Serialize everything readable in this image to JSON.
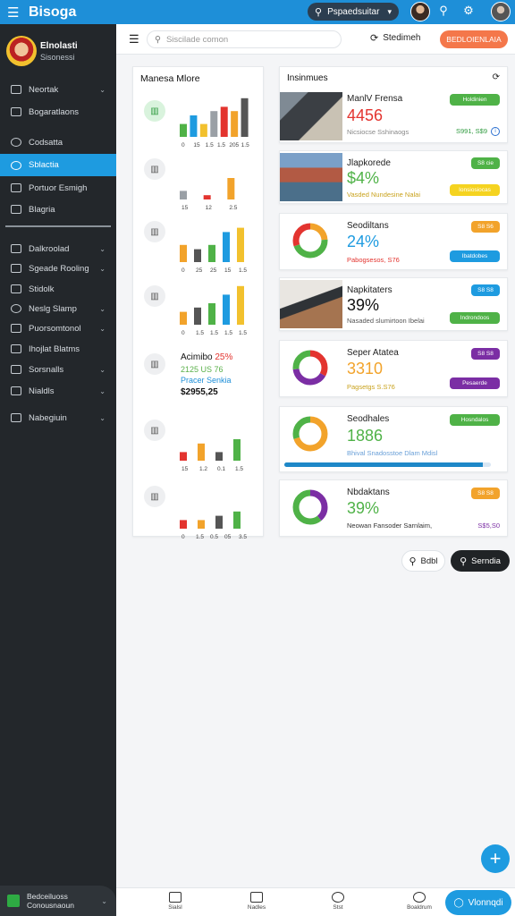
{
  "app": {
    "title": "Bisoga"
  },
  "topbar": {
    "search_label": "Pspaedsuitar",
    "icons": [
      "menu-icon",
      "search-icon",
      "avatar",
      "location-icon",
      "network-icon",
      "profile-avatar"
    ]
  },
  "sidebar": {
    "profile": {
      "name": "Elnolasti",
      "subtitle": "Sisonessi"
    },
    "items": [
      {
        "label": "Neortak",
        "chevron": true
      },
      {
        "label": "Bogaratlaons",
        "chevron": false
      },
      {
        "label": "Codsatta",
        "chevron": false
      },
      {
        "label": "Sblactia",
        "chevron": false,
        "active": true
      },
      {
        "label": "Portuor Esmigh",
        "chevron": false
      },
      {
        "label": "Blagria",
        "chevron": false
      },
      {
        "label": "Dalkroolad",
        "chevron": true
      },
      {
        "label": "Sgeade Rooling",
        "chevron": true
      },
      {
        "label": "Stidolk",
        "chevron": false
      },
      {
        "label": "Neslg Slamp",
        "chevron": true
      },
      {
        "label": "Puorsomtonol",
        "chevron": true
      },
      {
        "label": "Ihojlat Blatms",
        "chevron": false
      },
      {
        "label": "Sorsnalls",
        "chevron": true
      },
      {
        "label": "Nialdls",
        "chevron": true
      },
      {
        "label": "Nabegiuin",
        "chevron": true
      }
    ],
    "footer": {
      "line1": "Bedceiluoss",
      "line2": "Conousnaoun"
    }
  },
  "header": {
    "search_placeholder": "Siscilade comon",
    "button_label": "Stedimeh",
    "cta_label": "BEDLOIENLAIA"
  },
  "left_panel": {
    "title": "Manesa Mlore",
    "rows": [
      {
        "ticks": [
          "0",
          "15",
          "1.5",
          "1.5",
          "205",
          "1.5"
        ],
        "values": [
          3,
          5,
          3,
          6,
          7,
          6,
          9
        ]
      },
      {
        "ticks": [
          "15",
          "12",
          "2.5"
        ],
        "values": [
          2,
          1,
          5
        ]
      },
      {
        "ticks": [
          "0",
          "25",
          "25",
          "15",
          "1.5"
        ],
        "values": [
          4,
          3,
          4,
          7,
          8
        ]
      },
      {
        "ticks": [
          "0",
          "1.5",
          "1.5",
          "1.5",
          "1.5"
        ],
        "values": [
          3,
          4,
          5,
          7,
          9
        ]
      },
      {
        "ticks": [],
        "values": []
      },
      {
        "ticks": [
          "15",
          "1.2",
          "0.1",
          "1.5"
        ],
        "values": [
          2,
          4,
          2,
          5
        ]
      },
      {
        "ticks": [
          "0",
          "1.5",
          "0.5",
          "05",
          "3.5"
        ],
        "values": [
          2,
          2,
          3,
          4
        ]
      }
    ],
    "activity": {
      "title": "Acimibo",
      "highlight": "25%",
      "line2": "2125 US 76",
      "line3": "Pracer Senkia",
      "amount": "$2955,25"
    }
  },
  "insights": {
    "title": "Insinmues",
    "cards": [
      {
        "label": "ManlV Frensa",
        "value": "4456",
        "sub": "Nicsiocse Sshinaogs",
        "pill": "Holdinien",
        "small": "S991, S$9"
      },
      {
        "label": "Jlapkorede",
        "value": "$4%",
        "sub": "Vasded Nundesine Nalai",
        "pill": "S8 cie",
        "pill2": "Ionsiosiocas"
      },
      {
        "label": "Seodiltans",
        "value": "24%",
        "sub": "Pabogsesos, S76",
        "pill": "S8 S6",
        "pill2": "Ibatdobes"
      },
      {
        "label": "Napkitaters",
        "value": "39%",
        "sub": "Nasaded slumirtoon Ibelai",
        "pill": "S8 S8",
        "pill2": "Indrondoos"
      },
      {
        "label": "Seper Atatea",
        "value": "3310",
        "sub": "Pagsetgs S.S76",
        "pill": "S8 S8",
        "pill2": "Pesaerde"
      },
      {
        "label": "Seodhales",
        "value": "1886",
        "sub": "Bhival Snadosstoe Dlam Mdisl",
        "pill": "Hosndalos",
        "progress": 0.96
      },
      {
        "label": "Nbdaktans",
        "value": "39%",
        "sub": "Neowan Fansoder Sarnlaim,",
        "pill": "S8 S8",
        "small": "S$5,S0"
      }
    ]
  },
  "chips": {
    "light": "Bdbl",
    "dark": "Serndia"
  },
  "bottom_nav": {
    "items": [
      "Sialsl",
      "Nadles",
      "Stst",
      "Boaldrum"
    ],
    "cta": "Vlonnqdi"
  },
  "colors": {
    "primary": "#1e8fd8",
    "accent": "#f4774a",
    "sidebar": "#23272b",
    "green": "#4fb247",
    "orange": "#f2a32b",
    "purple": "#7b2ea4",
    "red": "#e3342f"
  }
}
